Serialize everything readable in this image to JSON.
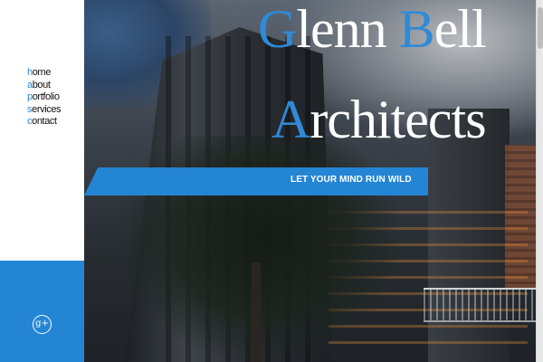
{
  "nav": {
    "items": [
      {
        "initial": "h",
        "rest": "ome"
      },
      {
        "initial": "a",
        "rest": "bout"
      },
      {
        "initial": "p",
        "rest": "ortfolio"
      },
      {
        "initial": "s",
        "rest": "ervices"
      },
      {
        "initial": "c",
        "rest": "ontact"
      }
    ]
  },
  "social": {
    "icon": "google-plus-icon",
    "glyph": "g+"
  },
  "hero": {
    "title_line1": {
      "cap1": "G",
      "rest1": "lenn ",
      "cap2": "B",
      "rest2": "ell"
    },
    "title_line2": {
      "cap": "A",
      "rest": "rchitects"
    },
    "tagline": "LET YOUR MIND RUN WILD"
  },
  "colors": {
    "accent": "#2485d4",
    "text_dark": "#111111",
    "white": "#ffffff"
  }
}
